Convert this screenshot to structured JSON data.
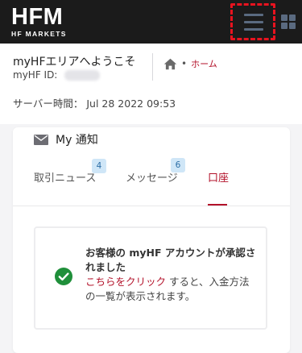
{
  "topbar": {
    "logo_text": "HFM",
    "logo_subtext": "HF MARKETS",
    "menu_icon": "hamburger-menu-icon",
    "apps_icon": "apps-grid-icon",
    "colors": {
      "background": "#1b1b1b",
      "highlight": "#e8131f"
    }
  },
  "header": {
    "welcome": "myHFエリアへようこそ",
    "myhf_id_label": "myHF ID:",
    "breadcrumb": {
      "home_icon": "home-icon",
      "separator": "•",
      "home_label": "ホーム"
    },
    "server_time_label": "サーバー時間：",
    "server_time_value": "Jul 28 2022 09:53"
  },
  "notifications": {
    "icon": "mail-icon",
    "title": "My 通知",
    "tabs": [
      {
        "label": "取引ニュース",
        "badge": "4",
        "active": false
      },
      {
        "label": "メッセージ",
        "badge": "6",
        "active": false
      },
      {
        "label": "口座",
        "badge": "",
        "active": true
      }
    ],
    "notice": {
      "icon": "check-circle-icon",
      "title": "お客様の myHF アカウントが承認されました",
      "link_text": "こちらをクリック",
      "body_text": "すると、入金方法の一覧が表示されます。"
    }
  },
  "colors": {
    "accent": "#b3122a",
    "badge_bg": "#cfe6f7",
    "success": "#1f8f3a"
  }
}
